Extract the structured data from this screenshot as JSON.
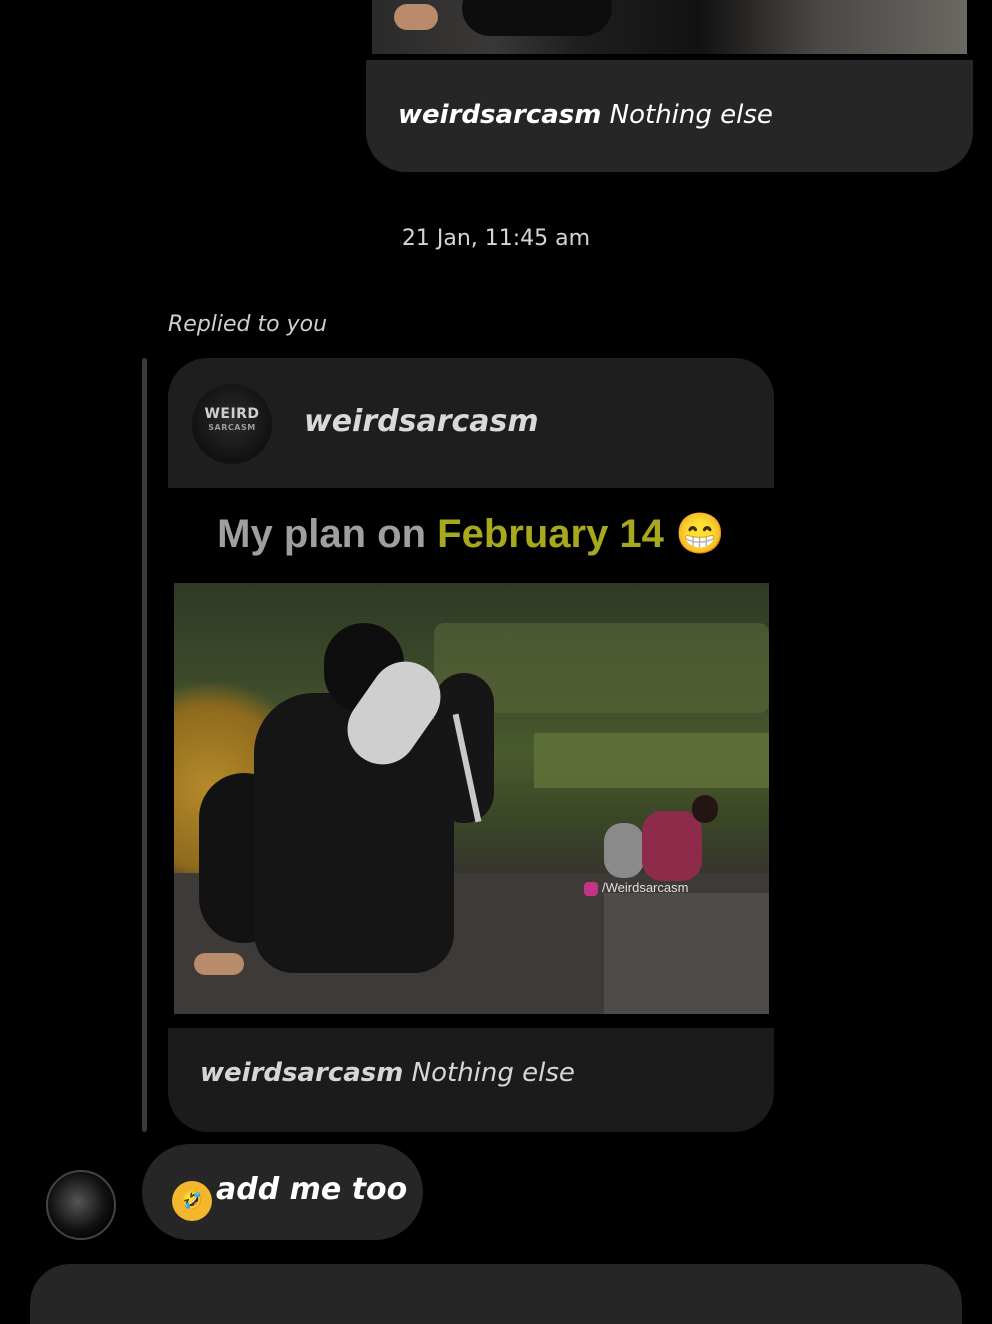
{
  "top_post": {
    "username": "weirdsarcasm",
    "caption": "Nothing else"
  },
  "timestamp": "21 Jan, 11:45 am",
  "reply": {
    "label": "Replied to you",
    "quoted_post": {
      "avatar_text_line1": "WEIRD",
      "avatar_text_line2": "SARCASM",
      "username": "weirdsarcasm",
      "title_prefix": "My plan on ",
      "title_highlight": "February 14",
      "title_emoji": "😁",
      "watermark": "/Weirdsarcasm",
      "caption_username": "weirdsarcasm",
      "caption": "Nothing else"
    }
  },
  "message": {
    "emoji": "🤣",
    "text": "add me too"
  },
  "colors": {
    "background": "#000000",
    "bubble": "#262626",
    "title_highlight": "#a8a81c"
  }
}
